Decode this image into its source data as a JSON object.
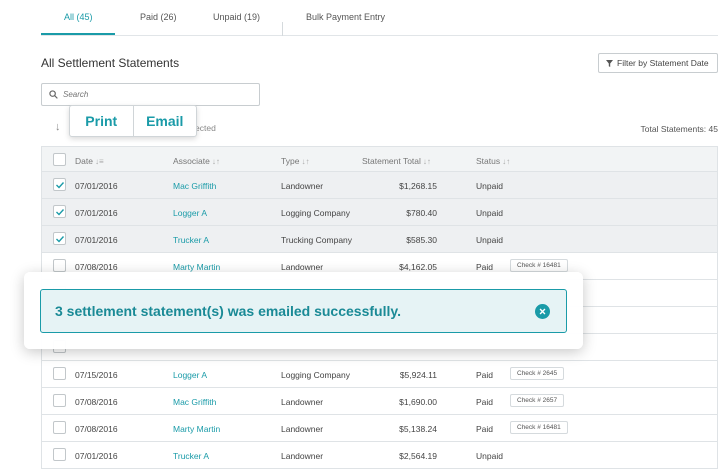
{
  "tabs": [
    {
      "label": "All (45)"
    },
    {
      "label": "Paid (26)"
    },
    {
      "label": "Unpaid (19)"
    },
    {
      "label": "Bulk Payment Entry"
    }
  ],
  "page_title": "All Settlement Statements",
  "filter_button": "Filter by Statement Date",
  "search": {
    "placeholder": "Search"
  },
  "sort_arrow": "↓",
  "selected_text": "ected",
  "total_statements": "Total Statements: 45",
  "popover": {
    "print": "Print",
    "email": "Email"
  },
  "table": {
    "headers": {
      "date": "Date",
      "associate": "Associate",
      "type": "Type",
      "total": "Statement Total",
      "status": "Status"
    },
    "rows": [
      {
        "checked": true,
        "date": "07/01/2016",
        "associate": "Mac Griffith",
        "type": "Landowner",
        "total": "$1,268.15",
        "status": "Unpaid",
        "check": ""
      },
      {
        "checked": true,
        "date": "07/01/2016",
        "associate": "Logger A",
        "type": "Logging Company",
        "total": "$780.40",
        "status": "Unpaid",
        "check": ""
      },
      {
        "checked": true,
        "date": "07/01/2016",
        "associate": "Trucker A",
        "type": "Trucking Company",
        "total": "$585.30",
        "status": "Unpaid",
        "check": ""
      },
      {
        "checked": false,
        "date": "07/08/2016",
        "associate": "Marty Martin",
        "type": "Landowner",
        "total": "$4,162.05",
        "status": "Paid",
        "check": "Check # 16481"
      },
      {
        "checked": false,
        "date": "",
        "associate": "",
        "type": "",
        "total": "",
        "status": "",
        "check": ""
      },
      {
        "checked": false,
        "date": "",
        "associate": "",
        "type": "",
        "total": "",
        "status": "",
        "check": ""
      },
      {
        "checked": false,
        "date": "",
        "associate": "",
        "type": "",
        "total": "",
        "status": "",
        "check": ""
      },
      {
        "checked": false,
        "date": "07/15/2016",
        "associate": "Logger A",
        "type": "Logging Company",
        "total": "$5,924.11",
        "status": "Paid",
        "check": "Check # 2645"
      },
      {
        "checked": false,
        "date": "07/08/2016",
        "associate": "Mac Griffith",
        "type": "Landowner",
        "total": "$1,690.00",
        "status": "Paid",
        "check": "Check # 2657"
      },
      {
        "checked": false,
        "date": "07/08/2016",
        "associate": "Marty Martin",
        "type": "Landowner",
        "total": "$5,138.24",
        "status": "Paid",
        "check": "Check # 16481"
      },
      {
        "checked": false,
        "date": "07/01/2016",
        "associate": "Trucker A",
        "type": "Landowner",
        "total": "$2,564.19",
        "status": "Unpaid",
        "check": ""
      }
    ]
  },
  "toast": {
    "message": "3 settlement statement(s) was emailed successfully."
  },
  "colors": {
    "accent": "#1a9ba8",
    "toast_bg": "#e6f3f5"
  }
}
